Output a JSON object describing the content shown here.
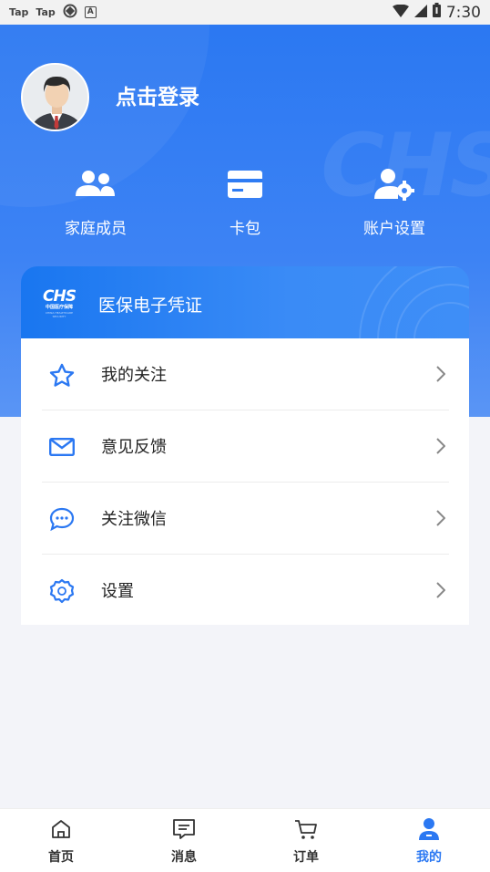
{
  "status_bar": {
    "left_items": [
      "Tap",
      "Tap"
    ],
    "time": "7:30",
    "icons": [
      "app-icon",
      "text-box-icon",
      "wifi-icon",
      "cell-signal-icon",
      "battery-icon"
    ]
  },
  "profile": {
    "login_text": "点击登录",
    "avatar": "user-avatar"
  },
  "quick_actions": [
    {
      "label": "家庭成员",
      "icon": "family-members-icon"
    },
    {
      "label": "卡包",
      "icon": "card-wallet-icon"
    },
    {
      "label": "账户设置",
      "icon": "account-settings-icon"
    }
  ],
  "banner": {
    "logo_text": "CHS",
    "logo_sub": "中国医疗保障",
    "logo_sub_en": "CHINA HEALTHCARE SECURITY",
    "title": "医保电子凭证"
  },
  "menu": [
    {
      "label": "我的关注",
      "icon": "star-icon"
    },
    {
      "label": "意见反馈",
      "icon": "mail-icon"
    },
    {
      "label": "关注微信",
      "icon": "chat-bubble-icon"
    },
    {
      "label": "设置",
      "icon": "settings-gear-icon"
    }
  ],
  "tabbar": [
    {
      "label": "首页",
      "icon": "home-icon",
      "active": false
    },
    {
      "label": "消息",
      "icon": "message-icon",
      "active": false
    },
    {
      "label": "订单",
      "icon": "cart-icon",
      "active": false
    },
    {
      "label": "我的",
      "icon": "profile-icon",
      "active": true
    }
  ],
  "colors": {
    "primary": "#2b78f2",
    "background": "#f3f4f9",
    "menu_icon": "#2b78f2"
  }
}
